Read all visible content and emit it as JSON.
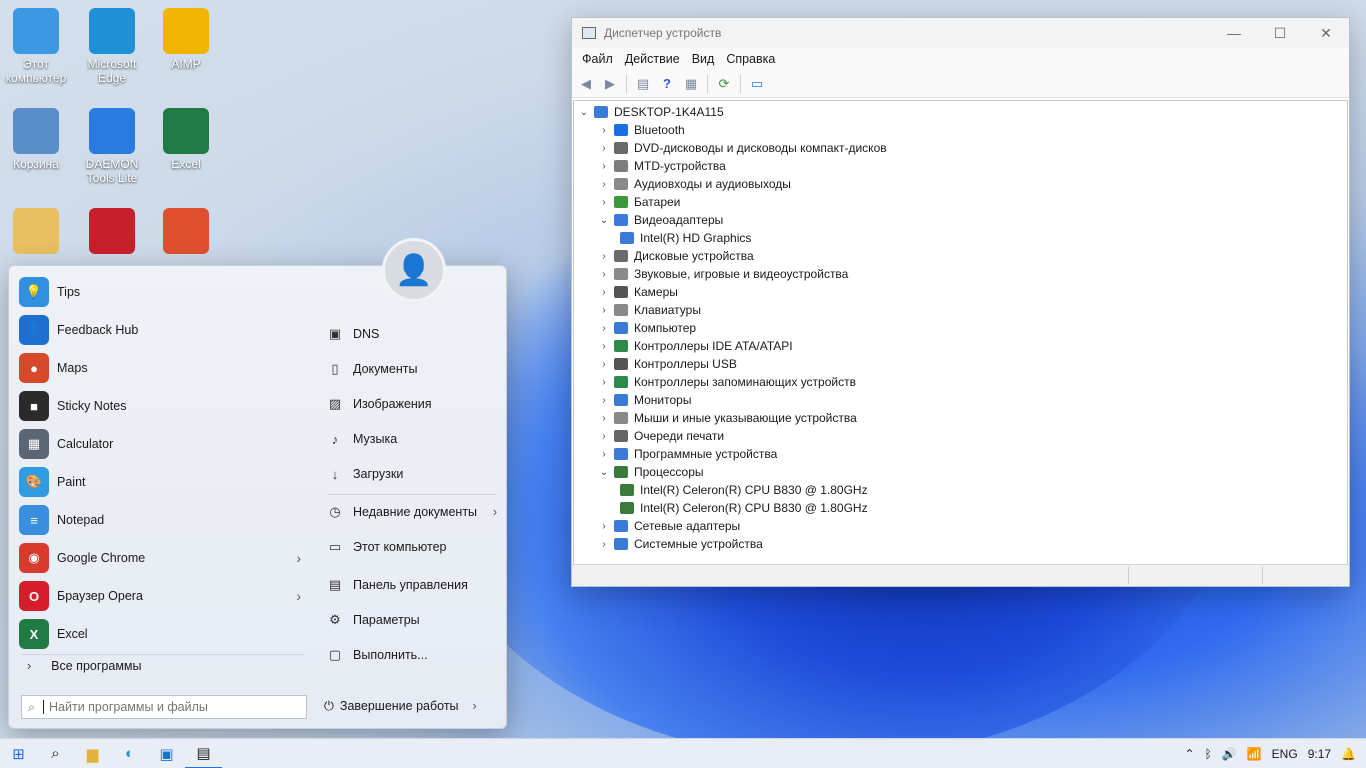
{
  "desktop": {
    "icons": [
      {
        "label": "Этот компьютер",
        "color": "#3b9ae1"
      },
      {
        "label": "Microsoft Edge",
        "color": "#1f8fd6"
      },
      {
        "label": "AIMP",
        "color": "#f1b400"
      },
      {
        "label": "Корзина",
        "color": "#5a8ec8"
      },
      {
        "label": "DAEMON Tools Lite",
        "color": "#2a7be0"
      },
      {
        "label": "Excel",
        "color": "#1f7a43"
      },
      {
        "label": "",
        "color": "#e8c060"
      },
      {
        "label": "",
        "color": "#c8202a"
      },
      {
        "label": "",
        "color": "#e0502e"
      }
    ]
  },
  "devmgr": {
    "title": "Диспетчер устройств",
    "menu": [
      "Файл",
      "Действие",
      "Вид",
      "Справка"
    ],
    "root": "DESKTOP-1K4A115",
    "items": [
      {
        "label": "Bluetooth",
        "expanded": false,
        "color": "#1a6fe0"
      },
      {
        "label": "DVD-дисководы и дисководы компакт-дисков",
        "expanded": false,
        "color": "#6a6a6a"
      },
      {
        "label": "MTD-устройства",
        "expanded": false,
        "color": "#7c7c7c"
      },
      {
        "label": "Аудиовходы и аудиовыходы",
        "expanded": false,
        "color": "#8a8a8a"
      },
      {
        "label": "Батареи",
        "expanded": false,
        "color": "#3a9a3a"
      },
      {
        "label": "Видеоадаптеры",
        "expanded": true,
        "color": "#3a7ad8"
      },
      {
        "label": "Intel(R) HD Graphics",
        "child": true,
        "color": "#3a7ad8"
      },
      {
        "label": "Дисковые устройства",
        "expanded": false,
        "color": "#6a6a6a"
      },
      {
        "label": "Звуковые, игровые и видеоустройства",
        "expanded": false,
        "color": "#8a8a8a"
      },
      {
        "label": "Камеры",
        "expanded": false,
        "color": "#555"
      },
      {
        "label": "Клавиатуры",
        "expanded": false,
        "color": "#888"
      },
      {
        "label": "Компьютер",
        "expanded": false,
        "color": "#3a7ad8"
      },
      {
        "label": "Контроллеры IDE ATA/ATAPI",
        "expanded": false,
        "color": "#2c8a4a"
      },
      {
        "label": "Контроллеры USB",
        "expanded": false,
        "color": "#555"
      },
      {
        "label": "Контроллеры запоминающих устройств",
        "expanded": false,
        "color": "#2c8a4a"
      },
      {
        "label": "Мониторы",
        "expanded": false,
        "color": "#3a7ad8"
      },
      {
        "label": "Мыши и иные указывающие устройства",
        "expanded": false,
        "color": "#888"
      },
      {
        "label": "Очереди печати",
        "expanded": false,
        "color": "#666"
      },
      {
        "label": "Программные устройства",
        "expanded": false,
        "color": "#3a7ad8"
      },
      {
        "label": "Процессоры",
        "expanded": true,
        "color": "#3a7a3a"
      },
      {
        "label": "Intel(R) Celeron(R) CPU B830 @ 1.80GHz",
        "child": true,
        "color": "#3a7a3a"
      },
      {
        "label": "Intel(R) Celeron(R) CPU B830 @ 1.80GHz",
        "child": true,
        "color": "#3a7a3a"
      },
      {
        "label": "Сетевые адаптеры",
        "expanded": false,
        "color": "#3a7ad8"
      },
      {
        "label": "Системные устройства",
        "expanded": false,
        "color": "#3a7ad8"
      }
    ]
  },
  "start": {
    "apps": [
      {
        "label": "Tips",
        "color": "#2f8fe0",
        "glyph": "💡",
        "submenu": false
      },
      {
        "label": "Feedback Hub",
        "color": "#1e6fd0",
        "glyph": "👤",
        "submenu": false
      },
      {
        "label": "Maps",
        "color": "#d6492a",
        "glyph": "●",
        "submenu": false
      },
      {
        "label": "Sticky Notes",
        "color": "#2b2b2b",
        "glyph": "■",
        "submenu": false
      },
      {
        "label": "Calculator",
        "color": "#5a6675",
        "glyph": "▦",
        "submenu": false
      },
      {
        "label": "Paint",
        "color": "#2f9be0",
        "glyph": "🎨",
        "submenu": false
      },
      {
        "label": "Notepad",
        "color": "#3a8ee0",
        "glyph": "≡",
        "submenu": false
      },
      {
        "label": "Google Chrome",
        "color": "#d93a2e",
        "glyph": "◉",
        "submenu": true
      },
      {
        "label": "Браузер Opera",
        "color": "#d61e2b",
        "glyph": "O",
        "submenu": true
      },
      {
        "label": "Excel",
        "color": "#1f7a43",
        "glyph": "X",
        "submenu": false
      }
    ],
    "all_programs": "Все программы",
    "search_placeholder": "Найти программы и файлы",
    "places": [
      {
        "label": "DNS",
        "glyph": "▣",
        "submenu": false
      },
      {
        "label": "Документы",
        "glyph": "▯",
        "submenu": false
      },
      {
        "label": "Изображения",
        "glyph": "▨",
        "submenu": false
      },
      {
        "label": "Музыка",
        "glyph": "♪",
        "submenu": false
      },
      {
        "label": "Загрузки",
        "glyph": "↓",
        "submenu": false
      },
      {
        "label": "Недавние документы",
        "glyph": "◷",
        "submenu": true
      },
      {
        "label": "Этот компьютер",
        "glyph": "▭",
        "submenu": false
      },
      {
        "label": "Панель управления",
        "glyph": "▤",
        "submenu": false
      },
      {
        "label": "Параметры",
        "glyph": "⚙",
        "submenu": false
      },
      {
        "label": "Выполнить...",
        "glyph": "▢",
        "submenu": false
      }
    ],
    "shutdown": "Завершение работы"
  },
  "taskbar": {
    "icons": [
      "start-icon",
      "search-icon",
      "file-explorer-icon",
      "edge-icon",
      "store-icon",
      "device-manager-icon"
    ],
    "lang": "ENG",
    "time": "9:17"
  }
}
